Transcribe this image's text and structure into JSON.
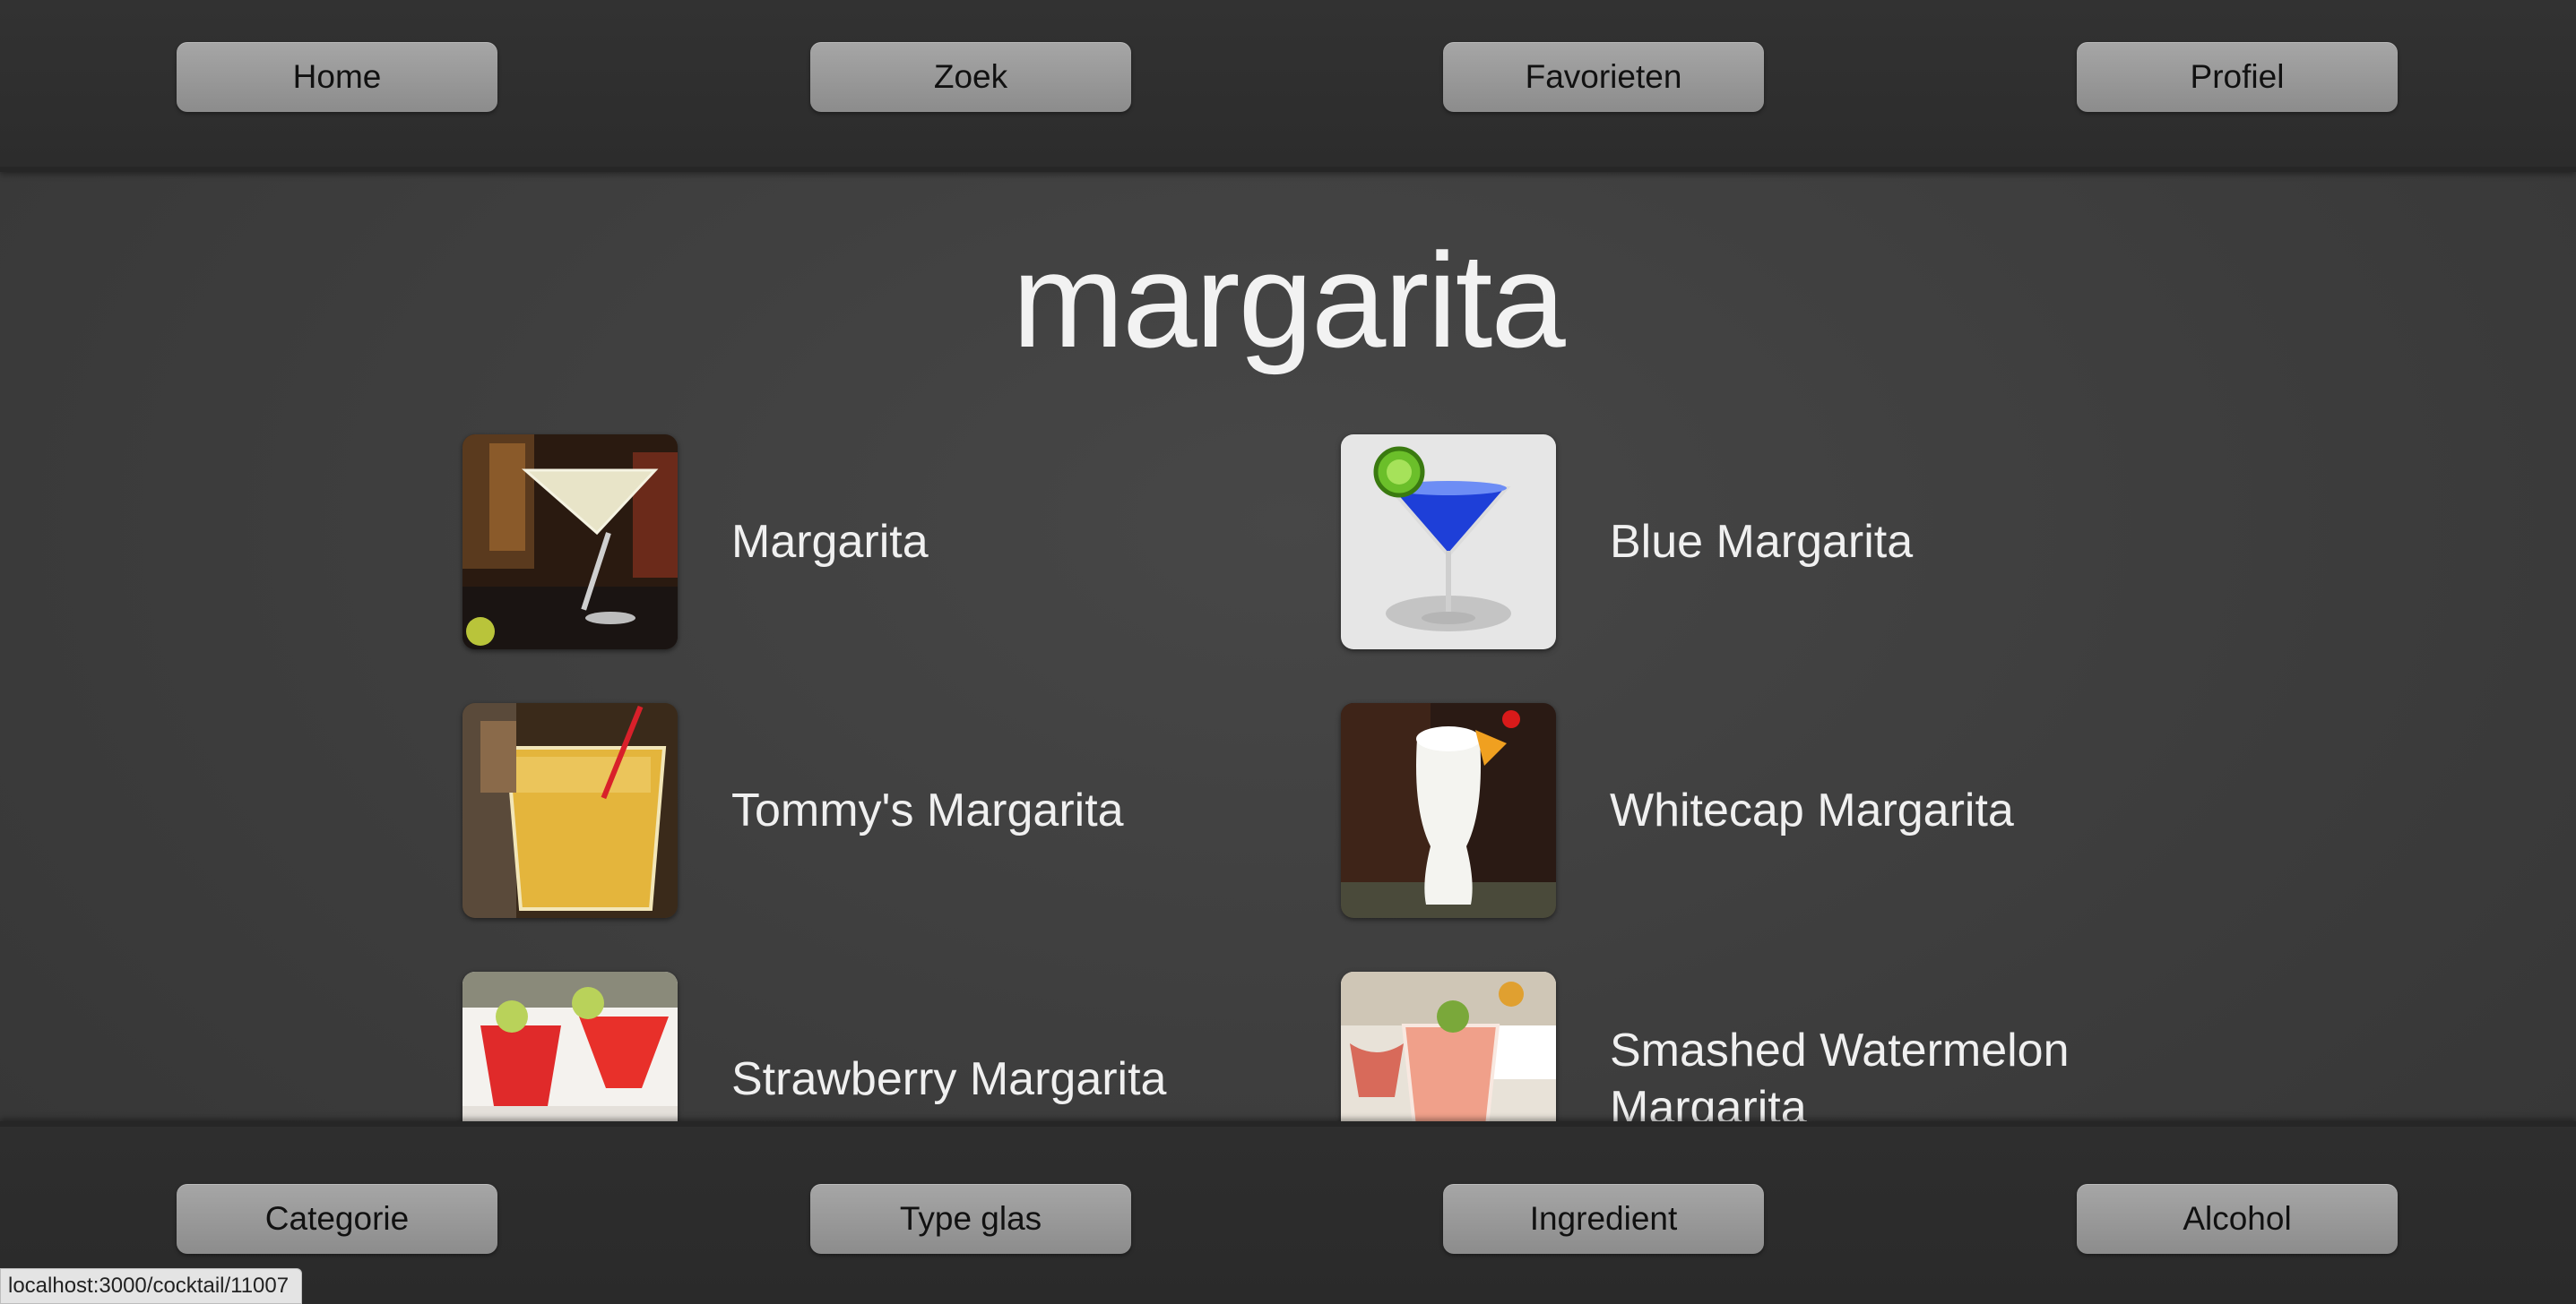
{
  "header": {
    "nav": [
      {
        "label": "Home"
      },
      {
        "label": "Zoek"
      },
      {
        "label": "Favorieten"
      },
      {
        "label": "Profiel"
      }
    ]
  },
  "main": {
    "title": "margarita",
    "results": [
      {
        "name": "Margarita",
        "image_icon": "margarita-photo"
      },
      {
        "name": "Blue Margarita",
        "image_icon": "blue-margarita-photo"
      },
      {
        "name": "Tommy's Margarita",
        "image_icon": "tommys-margarita-photo"
      },
      {
        "name": "Whitecap Margarita",
        "image_icon": "whitecap-margarita-photo"
      },
      {
        "name": "Strawberry Margarita",
        "image_icon": "strawberry-margarita-photo"
      },
      {
        "name": "Smashed Watermelon Margarita",
        "image_icon": "smashed-watermelon-margarita-photo"
      }
    ]
  },
  "footer": {
    "nav": [
      {
        "label": "Categorie"
      },
      {
        "label": "Type glas"
      },
      {
        "label": "Ingredient"
      },
      {
        "label": "Alcohol"
      }
    ]
  },
  "status_url": "localhost:3000/cocktail/11007",
  "colors": {
    "background": "#3e3e3e",
    "bar": "#2e2e2e",
    "button": "#9a9a9a",
    "text": "#f0f0f0"
  }
}
